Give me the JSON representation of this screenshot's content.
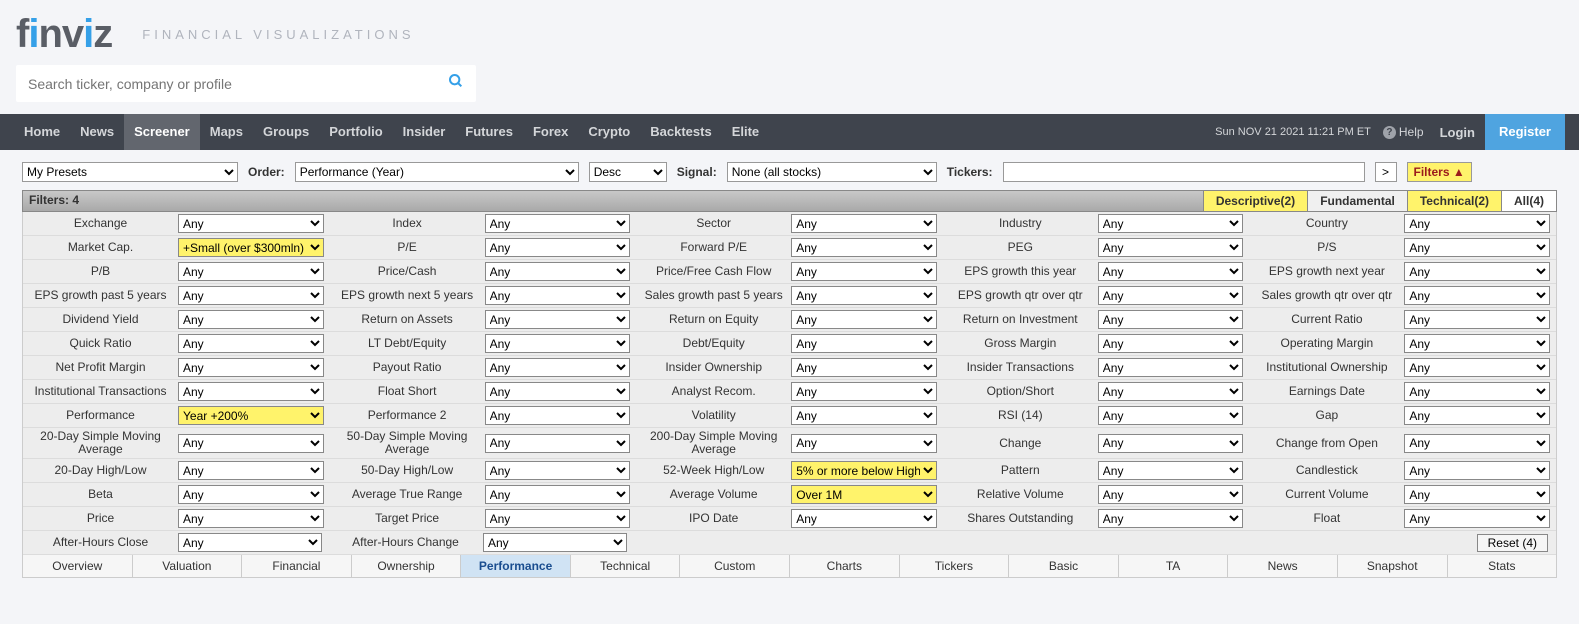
{
  "brand": {
    "name": "finviz",
    "tagline": "FINANCIAL VISUALIZATIONS"
  },
  "search": {
    "placeholder": "Search ticker, company or profile"
  },
  "nav": {
    "items": [
      "Home",
      "News",
      "Screener",
      "Maps",
      "Groups",
      "Portfolio",
      "Insider",
      "Futures",
      "Forex",
      "Crypto",
      "Backtests",
      "Elite"
    ],
    "active": 2,
    "time": "Sun NOV 21 2021 11:21 PM ET",
    "help": "Help",
    "login": "Login",
    "register": "Register"
  },
  "controls": {
    "presets": "My Presets",
    "order_label": "Order:",
    "order": "Performance (Year)",
    "direction": "Desc",
    "signal_label": "Signal:",
    "signal": "None (all stocks)",
    "tickers_label": "Tickers:",
    "go": ">",
    "filters_btn": "Filters ▲"
  },
  "filters_bar": {
    "label": "Filters:",
    "count": "4",
    "tabs": [
      {
        "label": "Descriptive(2)",
        "hl": true
      },
      {
        "label": "Fundamental",
        "hl": false
      },
      {
        "label": "Technical(2)",
        "hl": true
      },
      {
        "label": "All(4)",
        "hl": false,
        "active": true
      }
    ]
  },
  "filters": [
    [
      {
        "l": "Exchange",
        "v": "Any"
      },
      {
        "l": "Index",
        "v": "Any"
      },
      {
        "l": "Sector",
        "v": "Any"
      },
      {
        "l": "Industry",
        "v": "Any"
      },
      {
        "l": "Country",
        "v": "Any"
      }
    ],
    [
      {
        "l": "Market Cap.",
        "v": "+Small (over $300mln)",
        "hl": true
      },
      {
        "l": "P/E",
        "v": "Any"
      },
      {
        "l": "Forward P/E",
        "v": "Any"
      },
      {
        "l": "PEG",
        "v": "Any"
      },
      {
        "l": "P/S",
        "v": "Any"
      }
    ],
    [
      {
        "l": "P/B",
        "v": "Any"
      },
      {
        "l": "Price/Cash",
        "v": "Any"
      },
      {
        "l": "Price/Free Cash Flow",
        "v": "Any"
      },
      {
        "l": "EPS growth this year",
        "v": "Any"
      },
      {
        "l": "EPS growth next year",
        "v": "Any"
      }
    ],
    [
      {
        "l": "EPS growth past 5 years",
        "v": "Any"
      },
      {
        "l": "EPS growth next 5 years",
        "v": "Any"
      },
      {
        "l": "Sales growth past 5 years",
        "v": "Any"
      },
      {
        "l": "EPS growth qtr over qtr",
        "v": "Any"
      },
      {
        "l": "Sales growth qtr over qtr",
        "v": "Any"
      }
    ],
    [
      {
        "l": "Dividend Yield",
        "v": "Any"
      },
      {
        "l": "Return on Assets",
        "v": "Any"
      },
      {
        "l": "Return on Equity",
        "v": "Any"
      },
      {
        "l": "Return on Investment",
        "v": "Any"
      },
      {
        "l": "Current Ratio",
        "v": "Any"
      }
    ],
    [
      {
        "l": "Quick Ratio",
        "v": "Any"
      },
      {
        "l": "LT Debt/Equity",
        "v": "Any"
      },
      {
        "l": "Debt/Equity",
        "v": "Any"
      },
      {
        "l": "Gross Margin",
        "v": "Any"
      },
      {
        "l": "Operating Margin",
        "v": "Any"
      }
    ],
    [
      {
        "l": "Net Profit Margin",
        "v": "Any"
      },
      {
        "l": "Payout Ratio",
        "v": "Any"
      },
      {
        "l": "Insider Ownership",
        "v": "Any"
      },
      {
        "l": "Insider Transactions",
        "v": "Any"
      },
      {
        "l": "Institutional Ownership",
        "v": "Any"
      }
    ],
    [
      {
        "l": "Institutional Transactions",
        "v": "Any"
      },
      {
        "l": "Float Short",
        "v": "Any"
      },
      {
        "l": "Analyst Recom.",
        "v": "Any"
      },
      {
        "l": "Option/Short",
        "v": "Any"
      },
      {
        "l": "Earnings Date",
        "v": "Any"
      }
    ],
    [
      {
        "l": "Performance",
        "v": "Year +200%",
        "hl": true
      },
      {
        "l": "Performance 2",
        "v": "Any"
      },
      {
        "l": "Volatility",
        "v": "Any"
      },
      {
        "l": "RSI (14)",
        "v": "Any"
      },
      {
        "l": "Gap",
        "v": "Any"
      }
    ],
    [
      {
        "l": "20-Day Simple Moving Average",
        "v": "Any"
      },
      {
        "l": "50-Day Simple Moving Average",
        "v": "Any"
      },
      {
        "l": "200-Day Simple Moving Average",
        "v": "Any"
      },
      {
        "l": "Change",
        "v": "Any"
      },
      {
        "l": "Change from Open",
        "v": "Any"
      }
    ],
    [
      {
        "l": "20-Day High/Low",
        "v": "Any"
      },
      {
        "l": "50-Day High/Low",
        "v": "Any"
      },
      {
        "l": "52-Week High/Low",
        "v": "5% or more below High",
        "hl": true
      },
      {
        "l": "Pattern",
        "v": "Any"
      },
      {
        "l": "Candlestick",
        "v": "Any"
      }
    ],
    [
      {
        "l": "Beta",
        "v": "Any"
      },
      {
        "l": "Average True Range",
        "v": "Any"
      },
      {
        "l": "Average Volume",
        "v": "Over 1M",
        "hl": true
      },
      {
        "l": "Relative Volume",
        "v": "Any"
      },
      {
        "l": "Current Volume",
        "v": "Any"
      }
    ],
    [
      {
        "l": "Price",
        "v": "Any"
      },
      {
        "l": "Target Price",
        "v": "Any"
      },
      {
        "l": "IPO Date",
        "v": "Any"
      },
      {
        "l": "Shares Outstanding",
        "v": "Any"
      },
      {
        "l": "Float",
        "v": "Any"
      }
    ],
    [
      {
        "l": "After-Hours Close",
        "v": "Any"
      },
      {
        "l": "After-Hours Change",
        "v": "Any"
      }
    ]
  ],
  "reset": "Reset (4)",
  "views": [
    "Overview",
    "Valuation",
    "Financial",
    "Ownership",
    "Performance",
    "Technical",
    "Custom",
    "Charts",
    "Tickers",
    "Basic",
    "TA",
    "News",
    "Snapshot",
    "Stats"
  ],
  "views_active": 4
}
